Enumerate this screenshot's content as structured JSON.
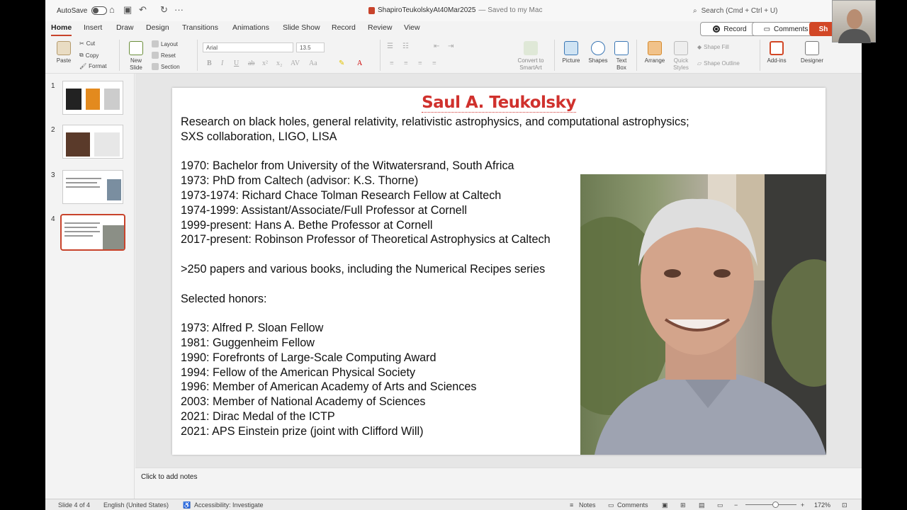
{
  "titlebar": {
    "autosave_label": "AutoSave",
    "doc_name": "ShapiroTeukolskyAt40Mar2025",
    "save_state": "— Saved to my Mac",
    "search_placeholder": "Search (Cmd + Ctrl + U)"
  },
  "tabs": [
    "Home",
    "Insert",
    "Draw",
    "Design",
    "Transitions",
    "Animations",
    "Slide Show",
    "Record",
    "Review",
    "View"
  ],
  "actions": {
    "record": "Record",
    "comments": "Comments",
    "share": "Sh"
  },
  "ribbon": {
    "paste": "Paste",
    "cut": "Cut",
    "copy": "Copy",
    "format": "Format",
    "new_slide": [
      "New",
      "Slide"
    ],
    "layout": "Layout",
    "reset": "Reset",
    "section": "Section",
    "font": "Arial",
    "size": "13.5",
    "convert": [
      "Convert to",
      "SmartArt"
    ],
    "picture": "Picture",
    "shapes": "Shapes",
    "textbox": [
      "Text",
      "Box"
    ],
    "arrange": "Arrange",
    "quick_styles": [
      "Quick",
      "Styles"
    ],
    "shape_fill": "Shape Fill",
    "shape_outline": "Shape Outline",
    "addins": "Add-ins",
    "designer": "Designer"
  },
  "thumbnails": [
    "1",
    "2",
    "3",
    "4"
  ],
  "slide": {
    "title": "Saul A. Teukolsky",
    "body": "Research on black holes, general relativity, relativistic astrophysics, and computational astrophysics;\nSXS collaboration, LIGO, LISA\n\n1970: Bachelor from University of the Witwatersrand, South Africa\n1973: PhD from Caltech (advisor: K.S. Thorne)\n1973-1974: Richard Chace Tolman Research Fellow at Caltech\n1974-1999: Assistant/Associate/Full Professor at Cornell\n1999-present: Hans A. Bethe Professor at Cornell\n2017-present: Robinson Professor of Theoretical Astrophysics at Caltech\n\n>250 papers and various books, including the Numerical Recipes series\n\nSelected honors:\n\n1973: Alfred P. Sloan Fellow\n1981: Guggenheim Fellow\n1990: Forefronts of Large-Scale Computing Award\n1994: Fellow of the American Physical Society\n1996: Member of American Academy of Arts and Sciences\n2003: Member of National Academy of Sciences\n2021: Dirac Medal of the ICTP\n2021: APS Einstein prize (joint with Clifford Will)"
  },
  "notes_placeholder": "Click to add notes",
  "status": {
    "slide": "Slide 4 of 4",
    "language": "English (United States)",
    "accessibility": "Accessibility: Investigate",
    "notes": "Notes",
    "comments": "Comments",
    "zoom": "172%"
  },
  "colors": {
    "accent": "#c8432b",
    "title": "#d0312d"
  }
}
